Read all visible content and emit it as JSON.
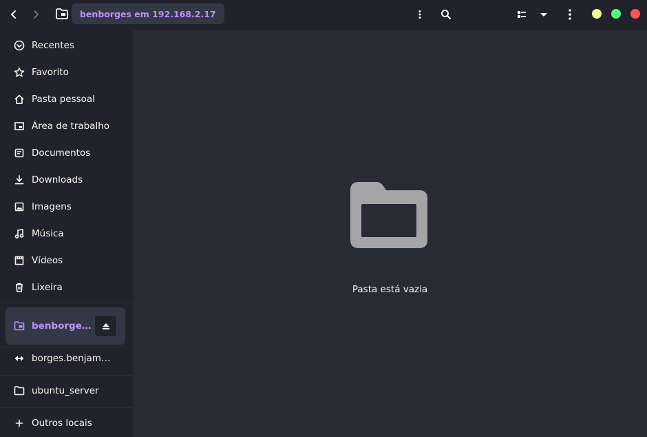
{
  "header": {
    "location": "benborges em 192.168.2.17"
  },
  "colors": {
    "background": "#282a36",
    "sidebar": "#21222c",
    "accent": "#bd93f9",
    "minimize": "#f1fa8c",
    "maximize": "#50fa7b",
    "close": "#ff5555"
  },
  "sidebar": {
    "items": [
      {
        "label": "Recentes",
        "icon": "recent-icon"
      },
      {
        "label": "Favorito",
        "icon": "star-icon"
      },
      {
        "label": "Pasta pessoal",
        "icon": "home-icon"
      },
      {
        "label": "Área de trabalho",
        "icon": "desktop-icon"
      },
      {
        "label": "Documentos",
        "icon": "document-icon"
      },
      {
        "label": "Downloads",
        "icon": "download-icon"
      },
      {
        "label": "Imagens",
        "icon": "image-icon"
      },
      {
        "label": "Música",
        "icon": "music-icon"
      },
      {
        "label": "Vídeos",
        "icon": "video-icon"
      },
      {
        "label": "Lixeira",
        "icon": "trash-icon"
      }
    ],
    "mounts": [
      {
        "label": "benborges em 192.168.2.17",
        "icon": "network-folder-icon",
        "active": true
      },
      {
        "label": "borges.benjamim@gmail.com",
        "icon": "network-share-icon"
      },
      {
        "label": "ubuntu_server",
        "icon": "folder-icon"
      }
    ],
    "other_locations": "Outros locais"
  },
  "content": {
    "empty_message": "Pasta está vazia"
  }
}
